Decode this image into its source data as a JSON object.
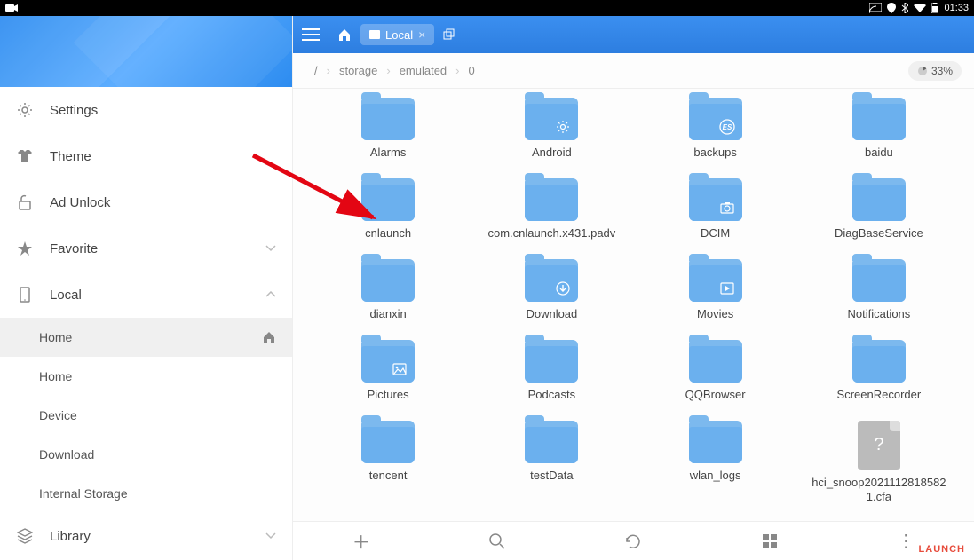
{
  "status": {
    "time": "01:33"
  },
  "sidebar": {
    "items": [
      {
        "label": "Settings"
      },
      {
        "label": "Theme"
      },
      {
        "label": "Ad Unlock"
      },
      {
        "label": "Favorite"
      },
      {
        "label": "Local"
      },
      {
        "label": "Library"
      }
    ],
    "local_subs": [
      {
        "label": "Home",
        "active": true
      },
      {
        "label": "Home"
      },
      {
        "label": "Device"
      },
      {
        "label": "Download"
      },
      {
        "label": "Internal Storage"
      }
    ]
  },
  "header": {
    "tab_label": "Local"
  },
  "breadcrumb": {
    "root": "/",
    "parts": [
      "storage",
      "emulated",
      "0"
    ]
  },
  "storage_pct": "33%",
  "folders": [
    {
      "name": "Alarms",
      "badge": ""
    },
    {
      "name": "Android",
      "badge": "gear"
    },
    {
      "name": "backups",
      "badge": "es"
    },
    {
      "name": "baidu",
      "badge": ""
    },
    {
      "name": "cnlaunch",
      "badge": ""
    },
    {
      "name": "com.cnlaunch.x431.padv",
      "badge": ""
    },
    {
      "name": "DCIM",
      "badge": "camera"
    },
    {
      "name": "DiagBaseService",
      "badge": ""
    },
    {
      "name": "dianxin",
      "badge": ""
    },
    {
      "name": "Download",
      "badge": "download"
    },
    {
      "name": "Movies",
      "badge": "play"
    },
    {
      "name": "Notifications",
      "badge": ""
    },
    {
      "name": "Pictures",
      "badge": "image"
    },
    {
      "name": "Podcasts",
      "badge": ""
    },
    {
      "name": "QQBrowser",
      "badge": ""
    },
    {
      "name": "ScreenRecorder",
      "badge": ""
    },
    {
      "name": "tencent",
      "badge": ""
    },
    {
      "name": "testData",
      "badge": ""
    },
    {
      "name": "wlan_logs",
      "badge": ""
    }
  ],
  "files": [
    {
      "name": "hci_snoop20211128185821.cfa"
    }
  ],
  "watermark": "LAUNCH"
}
